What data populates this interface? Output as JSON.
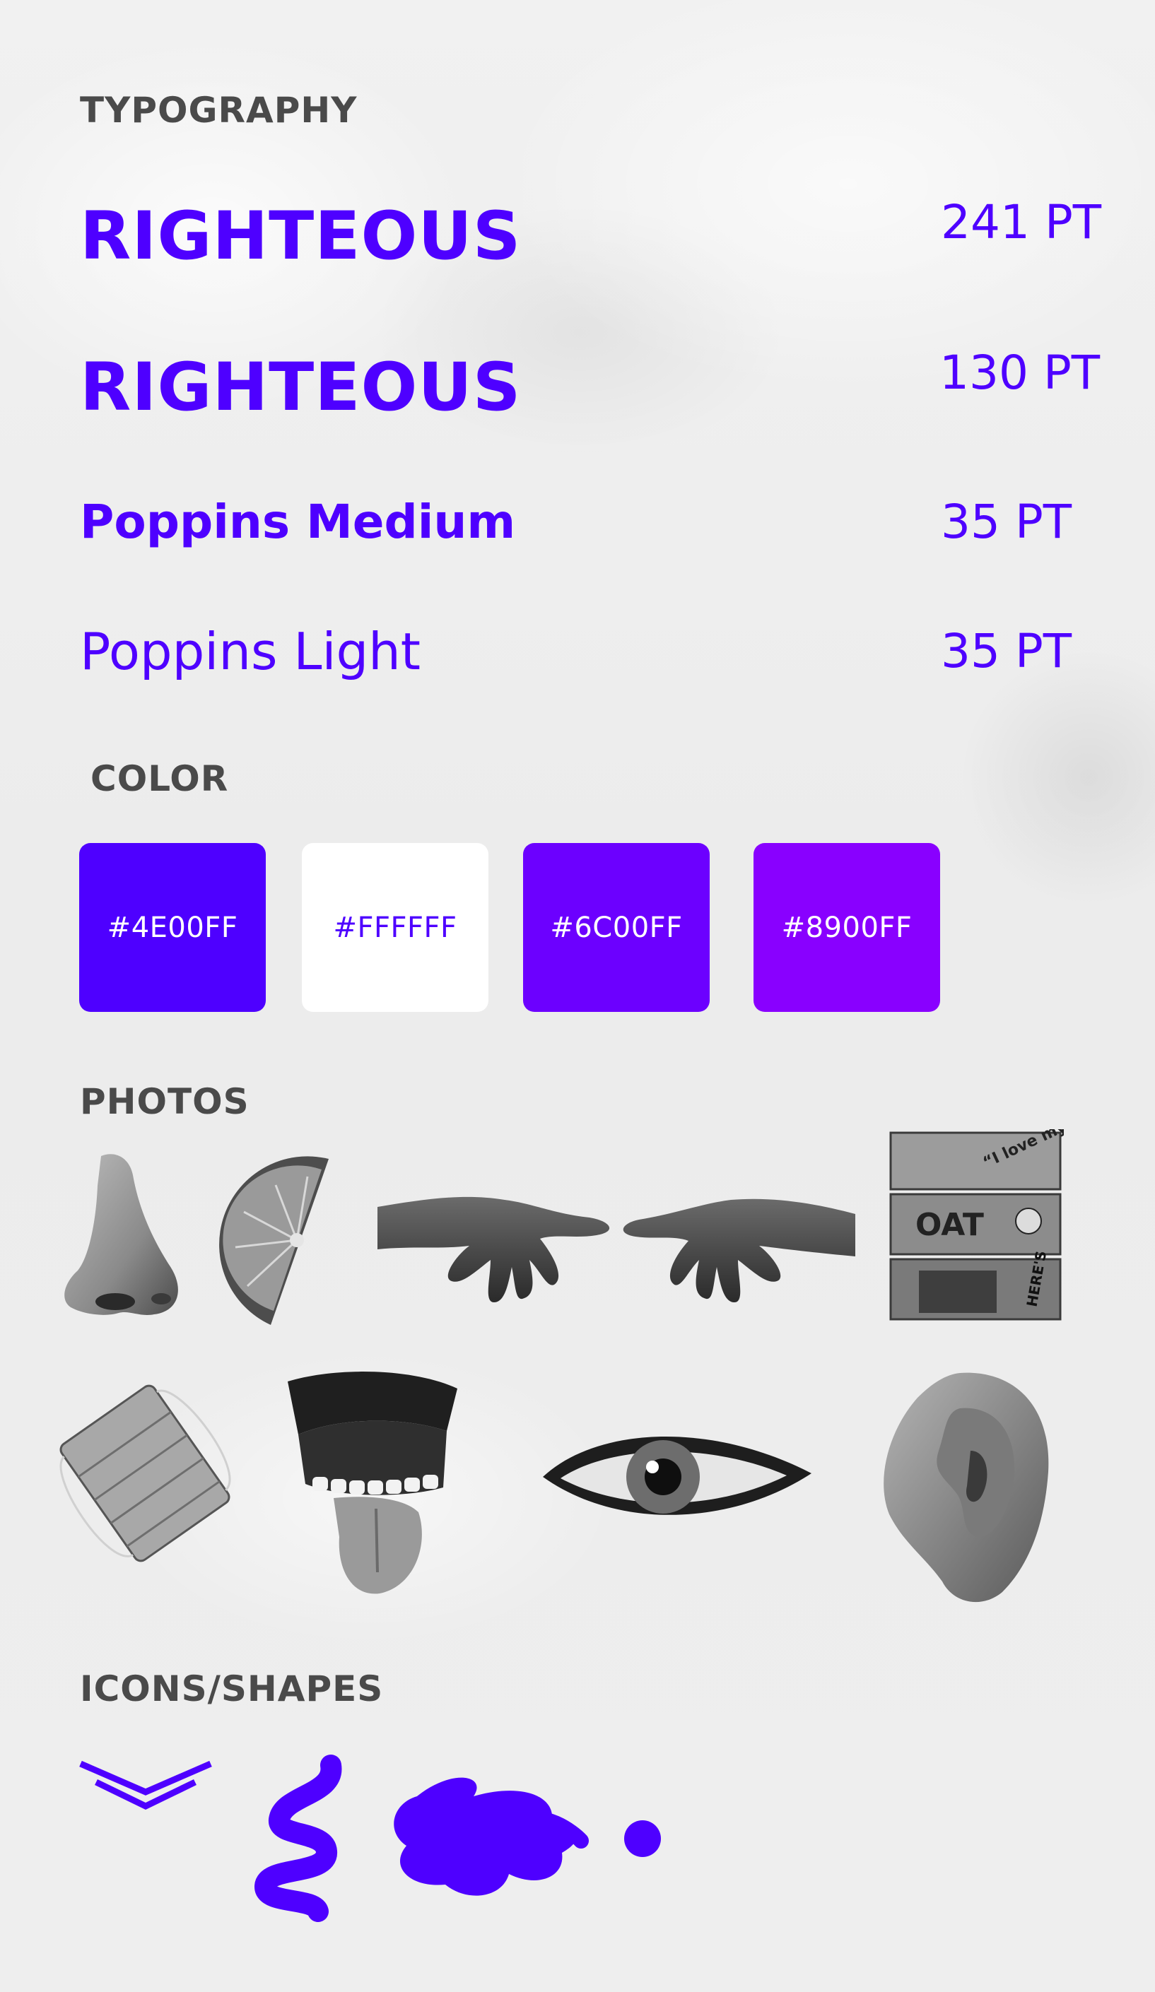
{
  "sections": {
    "typography": "TYPOGRAPHY",
    "color": "COLOR",
    "photos": "PHOTOS",
    "icons_shapes": "ICONS/SHAPES"
  },
  "typography": [
    {
      "name": "RIGHTEOUS",
      "size": "241 PT"
    },
    {
      "name": "RIGHTEOUS",
      "size": "130 PT"
    },
    {
      "name": "Poppins Medium",
      "size": "35 PT"
    },
    {
      "name": "Poppins Light",
      "size": "35 PT"
    }
  ],
  "colors": [
    {
      "hex": "#4E00FF",
      "fill": "#4e00ff",
      "text_color": "#ffffff"
    },
    {
      "hex": "#FFFFFF",
      "fill": "#ffffff",
      "text_color": "#4e00ff"
    },
    {
      "hex": "#6C00FF",
      "fill": "#6c00ff",
      "text_color": "#ffffff"
    },
    {
      "hex": "#8900FF",
      "fill": "#8900ff",
      "text_color": "#ffffff"
    }
  ],
  "photos": [
    {
      "icon": "nose-photo"
    },
    {
      "icon": "orange-slice-photo"
    },
    {
      "icon": "hands-photo"
    },
    {
      "icon": "oat-milk-cartons-photo"
    },
    {
      "icon": "face-mask-photo"
    },
    {
      "icon": "chattering-teeth-photo"
    },
    {
      "icon": "eye-photo"
    },
    {
      "icon": "ear-photo"
    }
  ],
  "shapes": [
    {
      "icon": "double-chevron-down-icon"
    },
    {
      "icon": "squiggle-shape"
    },
    {
      "icon": "scribble-shape"
    },
    {
      "icon": "dot-shape"
    }
  ],
  "accent_color": "#4e00ff"
}
